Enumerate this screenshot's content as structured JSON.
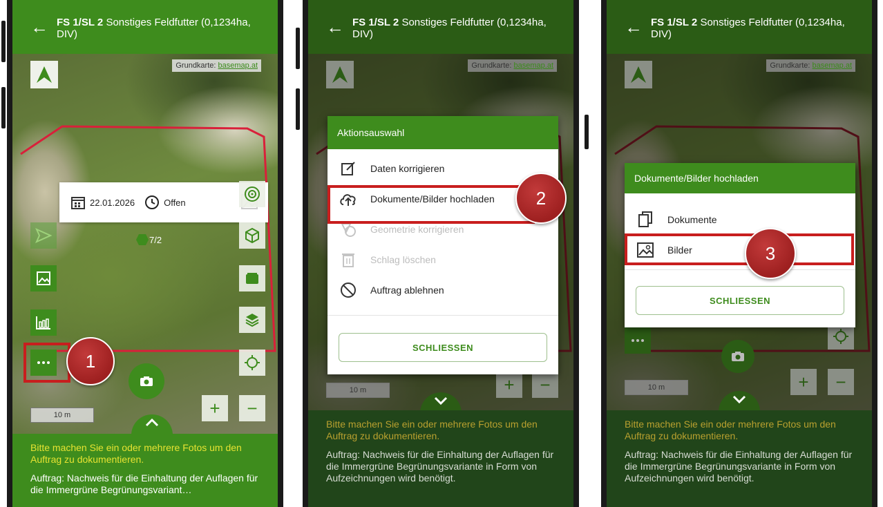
{
  "header": {
    "code": "FS 1/SL 2",
    "title": "Sonstiges Feldfutter (0,1234ha, DIV)"
  },
  "map": {
    "basemap_label": "Grundkarte:",
    "basemap_link": "basemap.at",
    "scale": "10 m"
  },
  "info_card": {
    "date": "22.01.2026",
    "status": "Offen",
    "count": "7/2"
  },
  "bottom": {
    "warning": "Bitte machen Sie ein oder mehrere Fotos um den Auftrag zu dokumentieren.",
    "task_short": "Auftrag: Nachweis für die Einhaltung der Auflagen für die Immergrüne Begrünungsvariant…",
    "task_full": "Auftrag: Nachweis für die Einhaltung der Auflagen für die Immergrüne Begrünungsvariante in Form von Aufzeichnungen wird benötigt."
  },
  "action_dialog": {
    "title": "Aktionsauswahl",
    "items": [
      {
        "label": "Daten korrigieren",
        "icon": "edit-icon",
        "enabled": true
      },
      {
        "label": "Dokumente/Bilder hochladen",
        "icon": "cloud-upload-icon",
        "enabled": true
      },
      {
        "label": "Geometrie korrigieren",
        "icon": "geometry-icon",
        "enabled": false
      },
      {
        "label": "Schlag löschen",
        "icon": "trash-icon",
        "enabled": false
      },
      {
        "label": "Auftrag ablehnen",
        "icon": "block-icon",
        "enabled": true
      }
    ],
    "close_label": "SCHLIESSEN"
  },
  "upload_dialog": {
    "title": "Dokumente/Bilder hochladen",
    "items": [
      {
        "label": "Dokumente",
        "icon": "documents-icon"
      },
      {
        "label": "Bilder",
        "icon": "image-icon"
      }
    ],
    "close_label": "SCHLIESSEN"
  },
  "steps": [
    "1",
    "2",
    "3"
  ],
  "colors": {
    "brand_green": "#3e8c1d",
    "highlight_red": "#c81e1e",
    "warning_yellow": "#e7e332"
  }
}
